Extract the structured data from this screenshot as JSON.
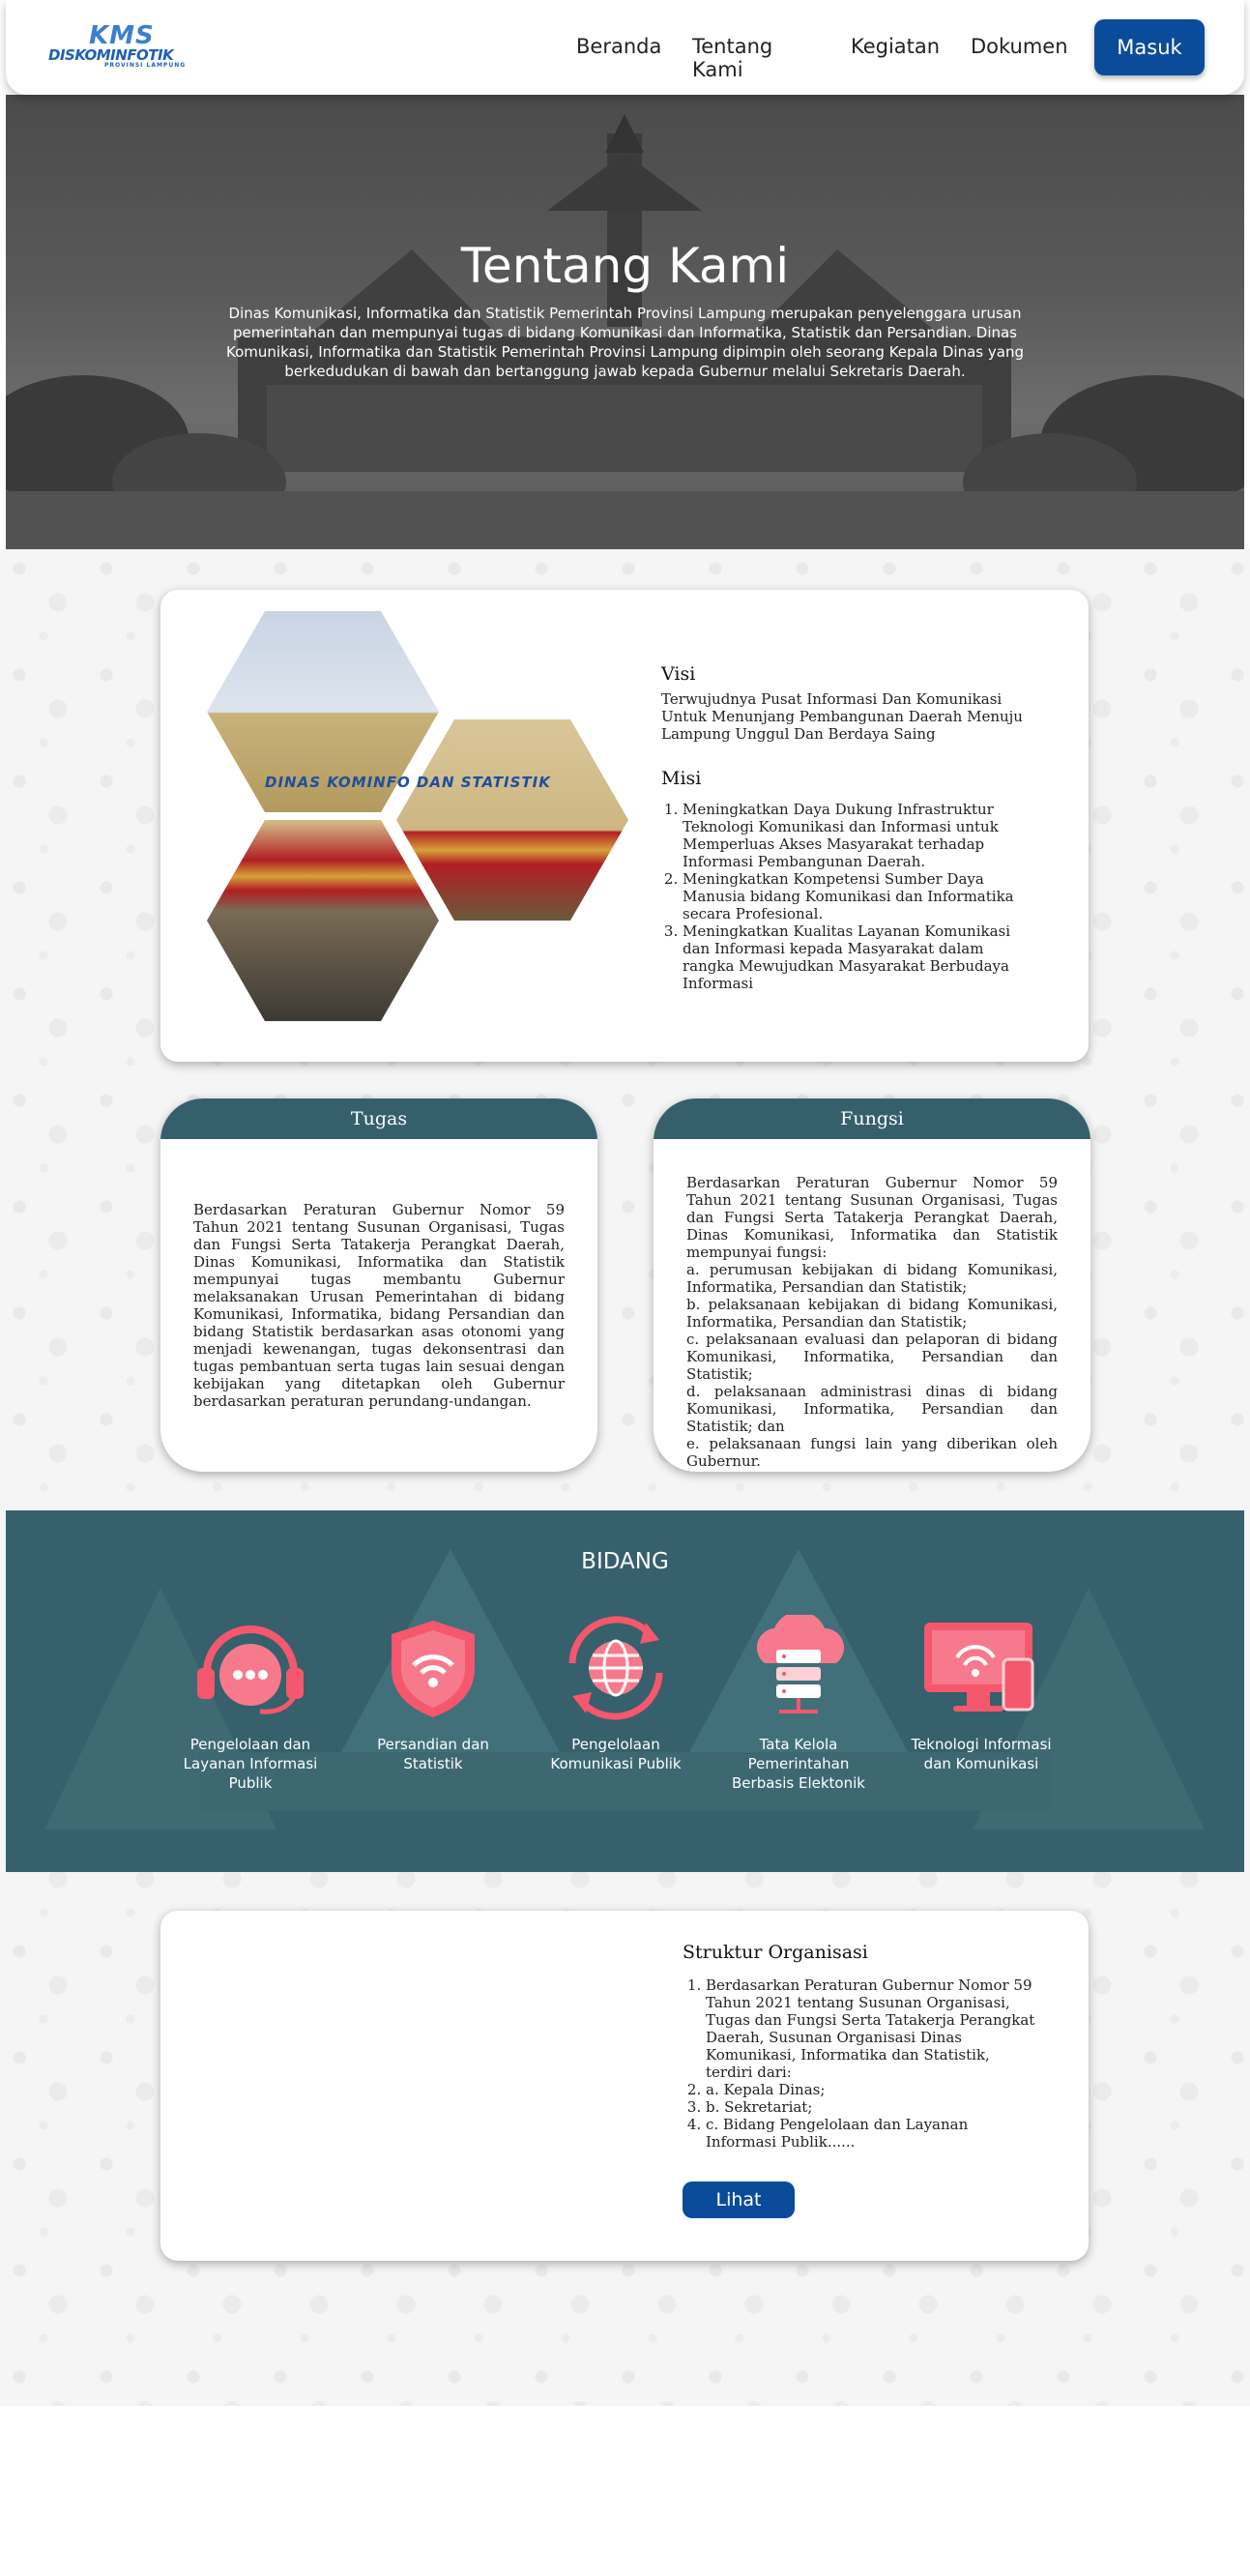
{
  "navbar": {
    "logo_kms": "KMS",
    "logo_name": "DISKOMINFOTIK",
    "logo_sub": "PROVINSI LAMPUNG",
    "links": [
      "Beranda",
      "Tentang Kami",
      "Kegiatan",
      "Dokumen"
    ],
    "login_label": "Masuk"
  },
  "hero": {
    "title": "Tentang Kami",
    "text": "Dinas Komunikasi, Informatika dan Statistik Pemerintah Provinsi Lampung merupakan penyelenggara urusan pemerintahan dan mempunyai tugas di bidang Komunikasi dan Informatika, Statistik dan Persandian. Dinas Komunikasi, Informatika dan Statistik Pemerintah Provinsi Lampung dipimpin oleh seorang Kepala Dinas yang berkedudukan di bawah dan bertanggung jawab kepada Gubernur melalui Sekretaris Daerah."
  },
  "visi_misi": {
    "building_sign": "DINAS KOMINFO DAN STATISTIK",
    "visi_title": "Visi",
    "visi_text": "Terwujudnya Pusat Informasi Dan Komunikasi Untuk Menunjang Pembangunan Daerah Menuju Lampung Unggul Dan Berdaya Saing",
    "misi_title": "Misi",
    "misi_items": [
      "Meningkatkan Daya Dukung Infrastruktur Teknologi Komunikasi dan Informasi untuk Memperluas Akses Masyarakat terhadap Informasi Pembangunan Daerah.",
      "Meningkatkan Kompetensi Sumber Daya Manusia bidang Komunikasi dan Informatika secara Profesional.",
      "Meningkatkan Kualitas Layanan Komunikasi dan Informasi kepada Masyarakat dalam rangka Mewujudkan Masyarakat Berbudaya Informasi"
    ]
  },
  "tugas": {
    "title": "Tugas",
    "text": "Berdasarkan Peraturan Gubernur Nomor 59 Tahun 2021 tentang Susunan Organisasi, Tugas dan Fungsi Serta Tatakerja Perangkat Daerah, Dinas Komunikasi, Informatika dan Statistik mempunyai tugas membantu Gubernur melaksanakan Urusan Pemerintahan di bidang Komunikasi, Informatika, bidang Persandian dan bidang Statistik berdasarkan asas otonomi yang menjadi kewenangan, tugas dekonsentrasi dan tugas pembantuan serta tugas lain sesuai dengan kebijakan yang ditetapkan oleh Gubernur berdasarkan peraturan perundang-undangan."
  },
  "fungsi": {
    "title": "Fungsi",
    "text": "Berdasarkan Peraturan Gubernur Nomor 59 Tahun 2021 tentang Susunan Organisasi, Tugas dan Fungsi Serta Tatakerja Perangkat Daerah, Dinas Komunikasi, Informatika dan Statistik mempunyai fungsi:\na. perumusan kebijakan di bidang Komunikasi, Informatika, Persandian dan Statistik;\nb. pelaksanaan kebijakan di bidang Komunikasi, Informatika, Persandian dan Statistik;\nc. pelaksanaan evaluasi dan pelaporan di bidang Komunikasi, Informatika, Persandian dan Statistik;\nd. pelaksanaan administrasi dinas di bidang Komunikasi, Informatika, Persandian dan Statistik; dan\ne. pelaksanaan fungsi lain yang diberikan oleh Gubernur."
  },
  "bidang": {
    "title": "BIDANG",
    "items": [
      {
        "icon": "headset-chat-icon",
        "label": "Pengelolaan dan Layanan Informasi Publik"
      },
      {
        "icon": "shield-wifi-icon",
        "label": "Persandian dan Statistik"
      },
      {
        "icon": "globe-sync-icon",
        "label": "Pengelolaan Komunikasi Publik"
      },
      {
        "icon": "cloud-server-icon",
        "label": "Tata Kelola Pemerintahan Berbasis Elektonik"
      },
      {
        "icon": "devices-wifi-icon",
        "label": "Teknologi Informasi dan Komunikasi"
      }
    ],
    "icon_color": "#f5576c"
  },
  "struktur": {
    "title": "Struktur Organisasi",
    "items": [
      "Berdasarkan Peraturan Gubernur Nomor 59 Tahun 2021 tentang Susunan Organisasi, Tugas dan Fungsi Serta Tatakerja Perangkat Daerah, Susunan Organisasi Dinas Komunikasi, Informatika dan Statistik, terdiri dari:",
      "a. Kepala Dinas;",
      "b. Sekretariat;",
      "c. Bidang Pengelolaan dan Layanan Informasi Publik......"
    ],
    "button_label": "Lihat"
  },
  "colors": {
    "primary": "#0b4c9a",
    "teal": "#35606b",
    "accent_pink": "#f5576c"
  }
}
